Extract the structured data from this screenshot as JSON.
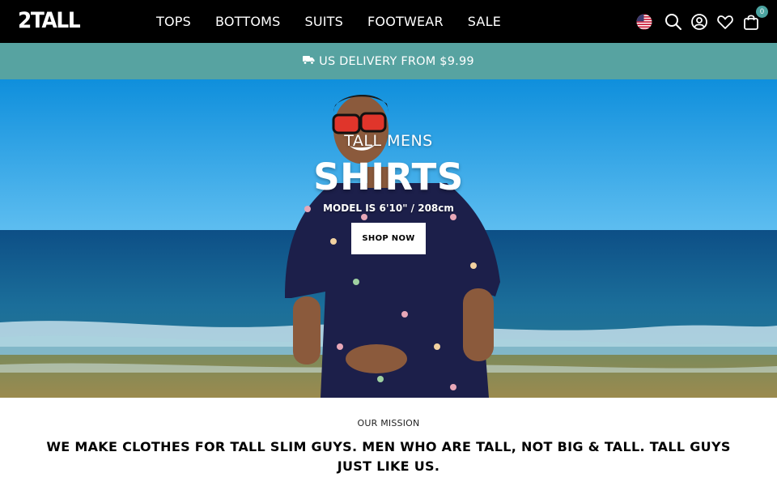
{
  "header": {
    "logo": "2TALL",
    "nav": [
      "TOPS",
      "BOTTOMS",
      "SUITS",
      "FOOTWEAR",
      "SALE"
    ],
    "icons": [
      "us-flag-icon",
      "search-icon",
      "account-icon",
      "heart-icon",
      "bag-icon"
    ],
    "cart_count": "0",
    "background": "#000000",
    "badge_color": "#4ba3a0"
  },
  "promo": {
    "icon": "delivery-truck-icon",
    "text": "US DELIVERY FROM $9.99",
    "background": "#57a3a1"
  },
  "hero": {
    "eyebrow": "TALL MENS",
    "title": "SHIRTS",
    "subtitle": "MODEL IS 6'10\" / 208cm",
    "button": "SHOP NOW"
  },
  "mission": {
    "label": "OUR MISSION",
    "text": "WE MAKE CLOTHES FOR TALL SLIM GUYS. MEN WHO ARE TALL, NOT BIG & TALL. TALL GUYS JUST LIKE US."
  }
}
